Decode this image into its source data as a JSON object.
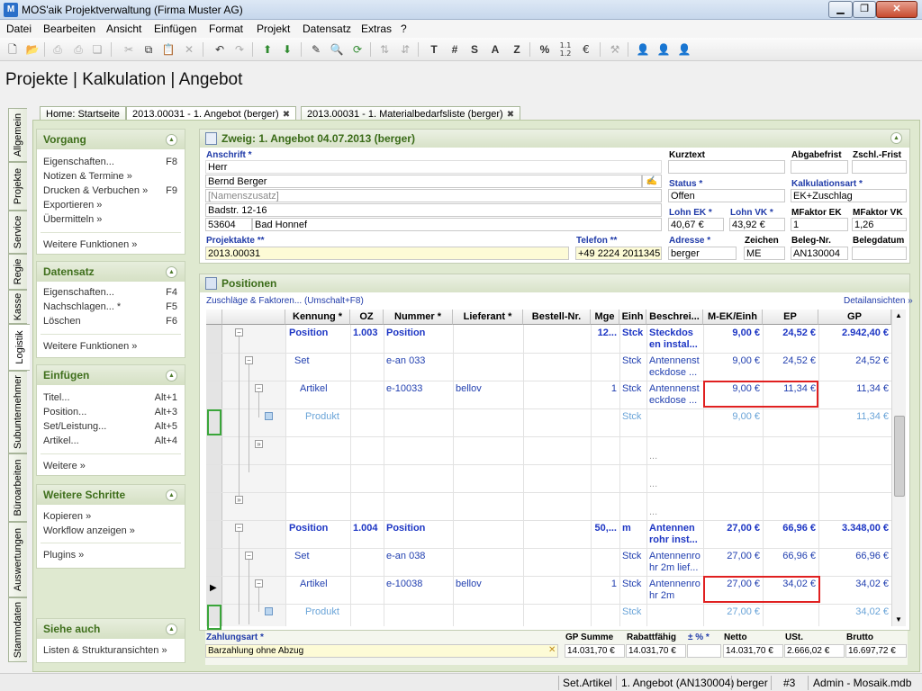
{
  "window": {
    "title": "MOS'aik Projektverwaltung (Firma Muster AG)"
  },
  "menu": [
    "Datei",
    "Bearbeiten",
    "Ansicht",
    "Einfügen",
    "Format",
    "Projekt",
    "Datensatz",
    "Extras",
    "?"
  ],
  "toolbar": {
    "text_buttons": [
      "T",
      "#",
      "S",
      "A",
      "Z",
      "%"
    ]
  },
  "heading": "Projekte | Kalkulation | Angebot",
  "tabs": [
    {
      "label": "Home: Startseite"
    },
    {
      "label": "2013.00031 - 1. Angebot (berger)"
    },
    {
      "label": "2013.00031 - 1. Materialbedarfsliste (berger)"
    }
  ],
  "vtabs": [
    "Allgemein",
    "Projekte",
    "Service",
    "Regie",
    "Kasse",
    "Logistik",
    "Subunternehmer",
    "Büroarbeiten",
    "Auswertungen",
    "Stammdaten"
  ],
  "left": {
    "vorgang": {
      "title": "Vorgang",
      "items": [
        {
          "label": "Eigenschaften...",
          "key": "F8"
        },
        {
          "label": "Notizen & Termine »",
          "key": ""
        },
        {
          "label": "Drucken & Verbuchen »",
          "key": "F9"
        },
        {
          "label": "Exportieren »",
          "key": ""
        },
        {
          "label": "Übermitteln »",
          "key": ""
        }
      ],
      "more": "Weitere Funktionen »"
    },
    "datensatz": {
      "title": "Datensatz",
      "items": [
        {
          "label": "Eigenschaften...",
          "key": "F4"
        },
        {
          "label": "Nachschlagen... *",
          "key": "F5"
        },
        {
          "label": "Löschen",
          "key": "F6"
        }
      ],
      "more": "Weitere Funktionen »"
    },
    "einfuegen": {
      "title": "Einfügen",
      "items": [
        {
          "label": "Titel...",
          "key": "Alt+1"
        },
        {
          "label": "Position...",
          "key": "Alt+3"
        },
        {
          "label": "Set/Leistung...",
          "key": "Alt+5"
        },
        {
          "label": "Artikel...",
          "key": "Alt+4"
        }
      ],
      "more": "Weitere »"
    },
    "schritte": {
      "title": "Weitere Schritte",
      "items": [
        "Kopieren »",
        "Workflow anzeigen »"
      ],
      "more": "Plugins »"
    },
    "siehe": {
      "title": "Siehe auch",
      "items": [
        "Listen & Strukturansichten »"
      ]
    }
  },
  "header_panel": {
    "title": "Zweig: 1. Angebot 04.07.2013 (berger)",
    "anschrift_label": "Anschrift *",
    "anrede": "Herr",
    "name": "Bernd Berger",
    "namenszusatz": "[Namenszusatz]",
    "strasse": "Badstr. 12-16",
    "plz": "53604",
    "ort": "Bad Honnef",
    "projektakte_label": "Projektakte **",
    "projektakte": "2013.00031",
    "telefon_label": "Telefon **",
    "telefon": "+49 2224 2011345",
    "kurztext_label": "Kurztext",
    "kurztext": "",
    "abgabefrist_label": "Abgabefrist",
    "zschl_label": "Zschl.-Frist",
    "status_label": "Status *",
    "status": "Offen",
    "kalkulationsart_label": "Kalkulationsart *",
    "kalkulationsart": "EK+Zuschlag",
    "lohnek_label": "Lohn EK *",
    "lohnek": "40,67 €",
    "lohnvk_label": "Lohn VK *",
    "lohnvk": "43,92 €",
    "mfaktorek_label": "MFaktor EK",
    "mfaktorek": "1",
    "mfaktorvk_label": "MFaktor VK",
    "mfaktorvk": "1,26",
    "adresse_label": "Adresse *",
    "adresse": "berger",
    "zeichen_label": "Zeichen",
    "zeichen": "ME",
    "belegnr_label": "Beleg-Nr.",
    "belegnr": "AN130004",
    "belegdatum_label": "Belegdatum",
    "belegdatum": ""
  },
  "positions": {
    "title": "Positionen",
    "link_left": "Zuschläge & Faktoren... (Umschalt+F8)",
    "link_right": "Detailansichten »",
    "columns": [
      "Kennung *",
      "OZ",
      "Nummer *",
      "Lieferant *",
      "Bestell-Nr.",
      "Mge",
      "Einh",
      "Beschrei...",
      "M-EK/Einh",
      "EP",
      "GP"
    ],
    "rows": [
      {
        "kennung": "Position",
        "oz": "1.003",
        "nummer": "Position",
        "lieferant": "",
        "mge": "12...",
        "einh": "Stck",
        "beschr1": "Steckdos",
        "beschr2": "en instal...",
        "mek": "9,00 €",
        "ep": "24,52 €",
        "gp": "2.942,40 €"
      },
      {
        "kennung": "Set",
        "oz": "",
        "nummer": "e-an 033",
        "lieferant": "",
        "mge": "",
        "einh": "Stck",
        "beschr1": "Antennenst",
        "beschr2": "eckdose ...",
        "mek": "9,00 €",
        "ep": "24,52 €",
        "gp": "24,52 €"
      },
      {
        "kennung": "Artikel",
        "oz": "",
        "nummer": "e-10033",
        "lieferant": "bellov",
        "mge": "1",
        "einh": "Stck",
        "beschr1": "Antennenst",
        "beschr2": "eckdose ...",
        "mek": "9,00 €",
        "ep": "11,34 €",
        "gp": "11,34 €"
      },
      {
        "kennung": "Produkt",
        "oz": "",
        "nummer": "",
        "lieferant": "",
        "mge": "",
        "einh": "Stck",
        "beschr1": "",
        "beschr2": "",
        "mek": "9,00 €",
        "ep": "",
        "gp": "11,34 €"
      },
      {
        "kennung": "",
        "oz": "",
        "nummer": "",
        "lieferant": "",
        "mge": "",
        "einh": "",
        "beschr1": "",
        "beschr2": "...",
        "mek": "",
        "ep": "",
        "gp": ""
      },
      {
        "kennung": "",
        "oz": "",
        "nummer": "",
        "lieferant": "",
        "mge": "",
        "einh": "",
        "beschr1": "",
        "beschr2": "...",
        "mek": "",
        "ep": "",
        "gp": ""
      },
      {
        "kennung": "",
        "oz": "",
        "nummer": "",
        "lieferant": "",
        "mge": "",
        "einh": "",
        "beschr1": "",
        "beschr2": "...",
        "mek": "",
        "ep": "",
        "gp": ""
      },
      {
        "kennung": "Position",
        "oz": "1.004",
        "nummer": "Position",
        "lieferant": "",
        "mge": "50,...",
        "einh": "m",
        "beschr1": "Antennen",
        "beschr2": "rohr inst...",
        "mek": "27,00 €",
        "ep": "66,96 €",
        "gp": "3.348,00 €"
      },
      {
        "kennung": "Set",
        "oz": "",
        "nummer": "e-an 038",
        "lieferant": "",
        "mge": "",
        "einh": "Stck",
        "beschr1": "Antennenro",
        "beschr2": "hr 2m lief...",
        "mek": "27,00 €",
        "ep": "66,96 €",
        "gp": "66,96 €"
      },
      {
        "kennung": "Artikel",
        "oz": "",
        "nummer": "e-10038",
        "lieferant": "bellov",
        "mge": "1",
        "einh": "Stck",
        "beschr1": "Antennenro",
        "beschr2": "hr 2m",
        "mek": "27,00 €",
        "ep": "34,02 €",
        "gp": "34,02 €"
      },
      {
        "kennung": "Produkt",
        "oz": "",
        "nummer": "",
        "lieferant": "",
        "mge": "",
        "einh": "Stck",
        "beschr1": "",
        "beschr2": "",
        "mek": "27,00 €",
        "ep": "",
        "gp": "34,02 €"
      }
    ]
  },
  "footer": {
    "zahlungsart_label": "Zahlungsart *",
    "zahlungsart": "Barzahlung ohne Abzug",
    "gpsumme_label": "GP Summe",
    "gpsumme": "14.031,70 €",
    "rabattfaehig_label": "Rabattfähig",
    "rabattfaehig": "14.031,70 €",
    "prozent_label": "± % *",
    "prozent": "",
    "netto_label": "Netto",
    "netto": "14.031,70 €",
    "ust_label": "USt.",
    "ust": "2.666,02 €",
    "brutto_label": "Brutto",
    "brutto": "16.697,72 €"
  },
  "statusbar": [
    "Set.Artikel",
    "1. Angebot (AN130004)",
    "berger",
    "#3",
    "Admin - Mosaik.mdb"
  ]
}
